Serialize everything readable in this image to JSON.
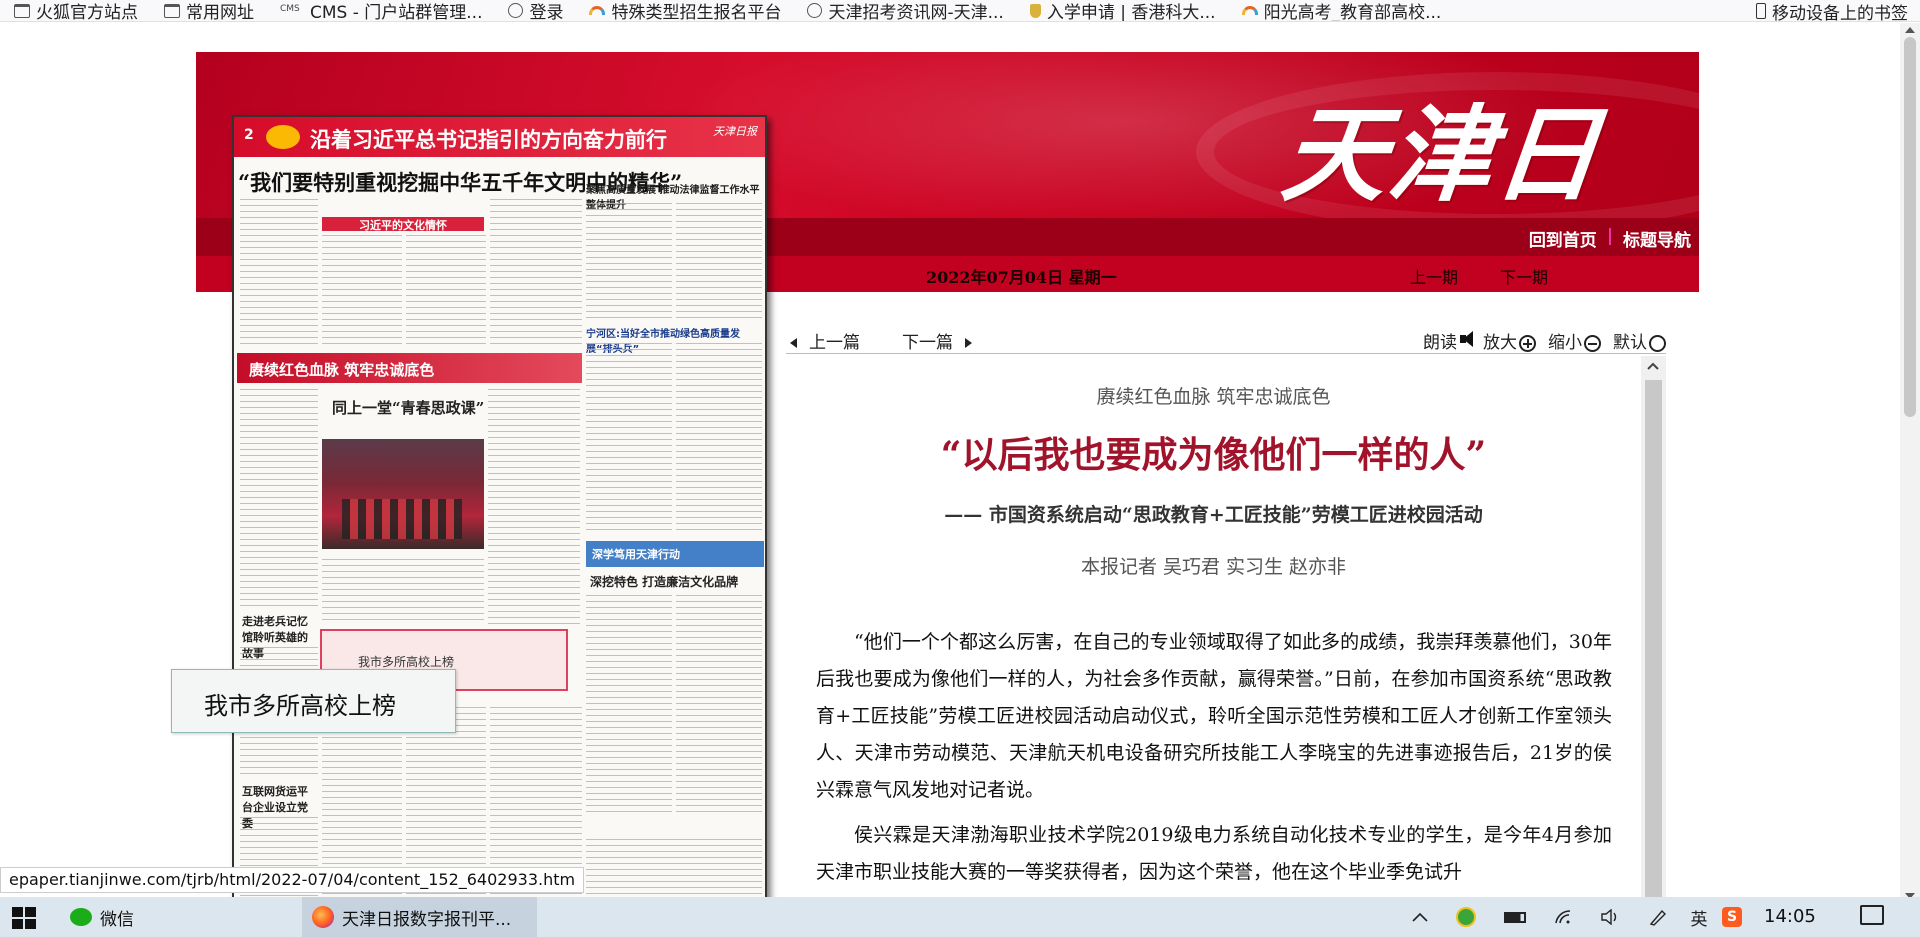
{
  "bookmarks": [
    {
      "label": "火狐官方站点",
      "icon": "folder-icon"
    },
    {
      "label": "常用网址",
      "icon": "folder-icon"
    },
    {
      "label": "CMS - 门户站群管理...",
      "icon": "cms-icon"
    },
    {
      "label": "登录",
      "icon": "globe-icon"
    },
    {
      "label": "特殊类型招生报名平台",
      "icon": "rainbow-icon"
    },
    {
      "label": "天津招考资讯网-天津...",
      "icon": "globe-icon"
    },
    {
      "label": "入学申请 | 香港科大...",
      "icon": "shield-icon"
    },
    {
      "label": "阳光高考_教育部高校...",
      "icon": "rainbow-icon"
    }
  ],
  "bookmarks_mobile": "移动设备上的书签",
  "header": {
    "logo": "天津日報",
    "nav_home": "回到首页",
    "nav_sep": "|",
    "nav_titles": "标题导航",
    "date": "2022年07月04日  星期一",
    "prev_issue": "上一期",
    "next_issue": "下一期"
  },
  "newspaper": {
    "page_num": "2",
    "slogan": "沿着习近平总书记指引的方向奋力前行",
    "paper_mark": "天津日报",
    "headline1": "“我们要特别重视挖掘中华五千年文明中的精华”",
    "box_culture": "习近平的文化情怀",
    "band": "赓续红色血脉  筑牢忠诚底色",
    "sub1": "同上一堂“青春思政课”",
    "highlight": "我市多所高校上榜",
    "feature_box": "深学笃用天津行动",
    "side1": "宁河区:当好全市推动绿色高质量发展“排头兵”",
    "side2": "深挖特色  打造廉洁文化品牌",
    "side3": "互联网货运平台企业设立党委",
    "side4": "走进老兵记忆馆聆听英雄的故事"
  },
  "tooltip": "我市多所高校上榜",
  "article_toolbar": {
    "prev_article": "上一篇",
    "next_article": "下一篇",
    "read": "朗读",
    "zoom_in": "放大",
    "zoom_out": "缩小",
    "default": "默认"
  },
  "article": {
    "kicker": "赓续红色血脉  筑牢忠诚底色",
    "headline": "“以后我也要成为像他们一样的人”",
    "subhead": "——  市国资系统启动“思政教育+工匠技能”劳模工匠进校园活动",
    "byline": "本报记者  吴巧君  实习生  赵亦非",
    "paragraphs": [
      "“他们一个个都这么厉害，在自己的专业领域取得了如此多的成绩，我崇拜羡慕他们，30年后我也要成为像他们一样的人，为社会多作贡献，赢得荣誉。”日前，在参加市国资系统“思政教育+工匠技能”劳模工匠进校园活动启动仪式，聆听全国示范性劳模和工匠人才创新工作室领头人、天津市劳动模范、天津航天机电设备研究所技能工人李晓宝的先进事迹报告后，21岁的侯兴霖意气风发地对记者说。",
      "侯兴霖是天津渤海职业技术学院2019级电力系统自动化技术专业的学生，是今年4月参加天津市职业技能大赛的一等奖获得者，因为这个荣誉，他在这个毕业季免试升"
    ]
  },
  "status_url": "epaper.tianjinwe.com/tjrb/html/2022-07/04/content_152_6402933.htm",
  "taskbar": {
    "wechat": "微信",
    "firefox": "天津日报数字报刊平...",
    "ime": "英",
    "time": "14:05"
  },
  "colors": {
    "brand_red": "#c8001f",
    "headline_red": "#a0132a"
  }
}
